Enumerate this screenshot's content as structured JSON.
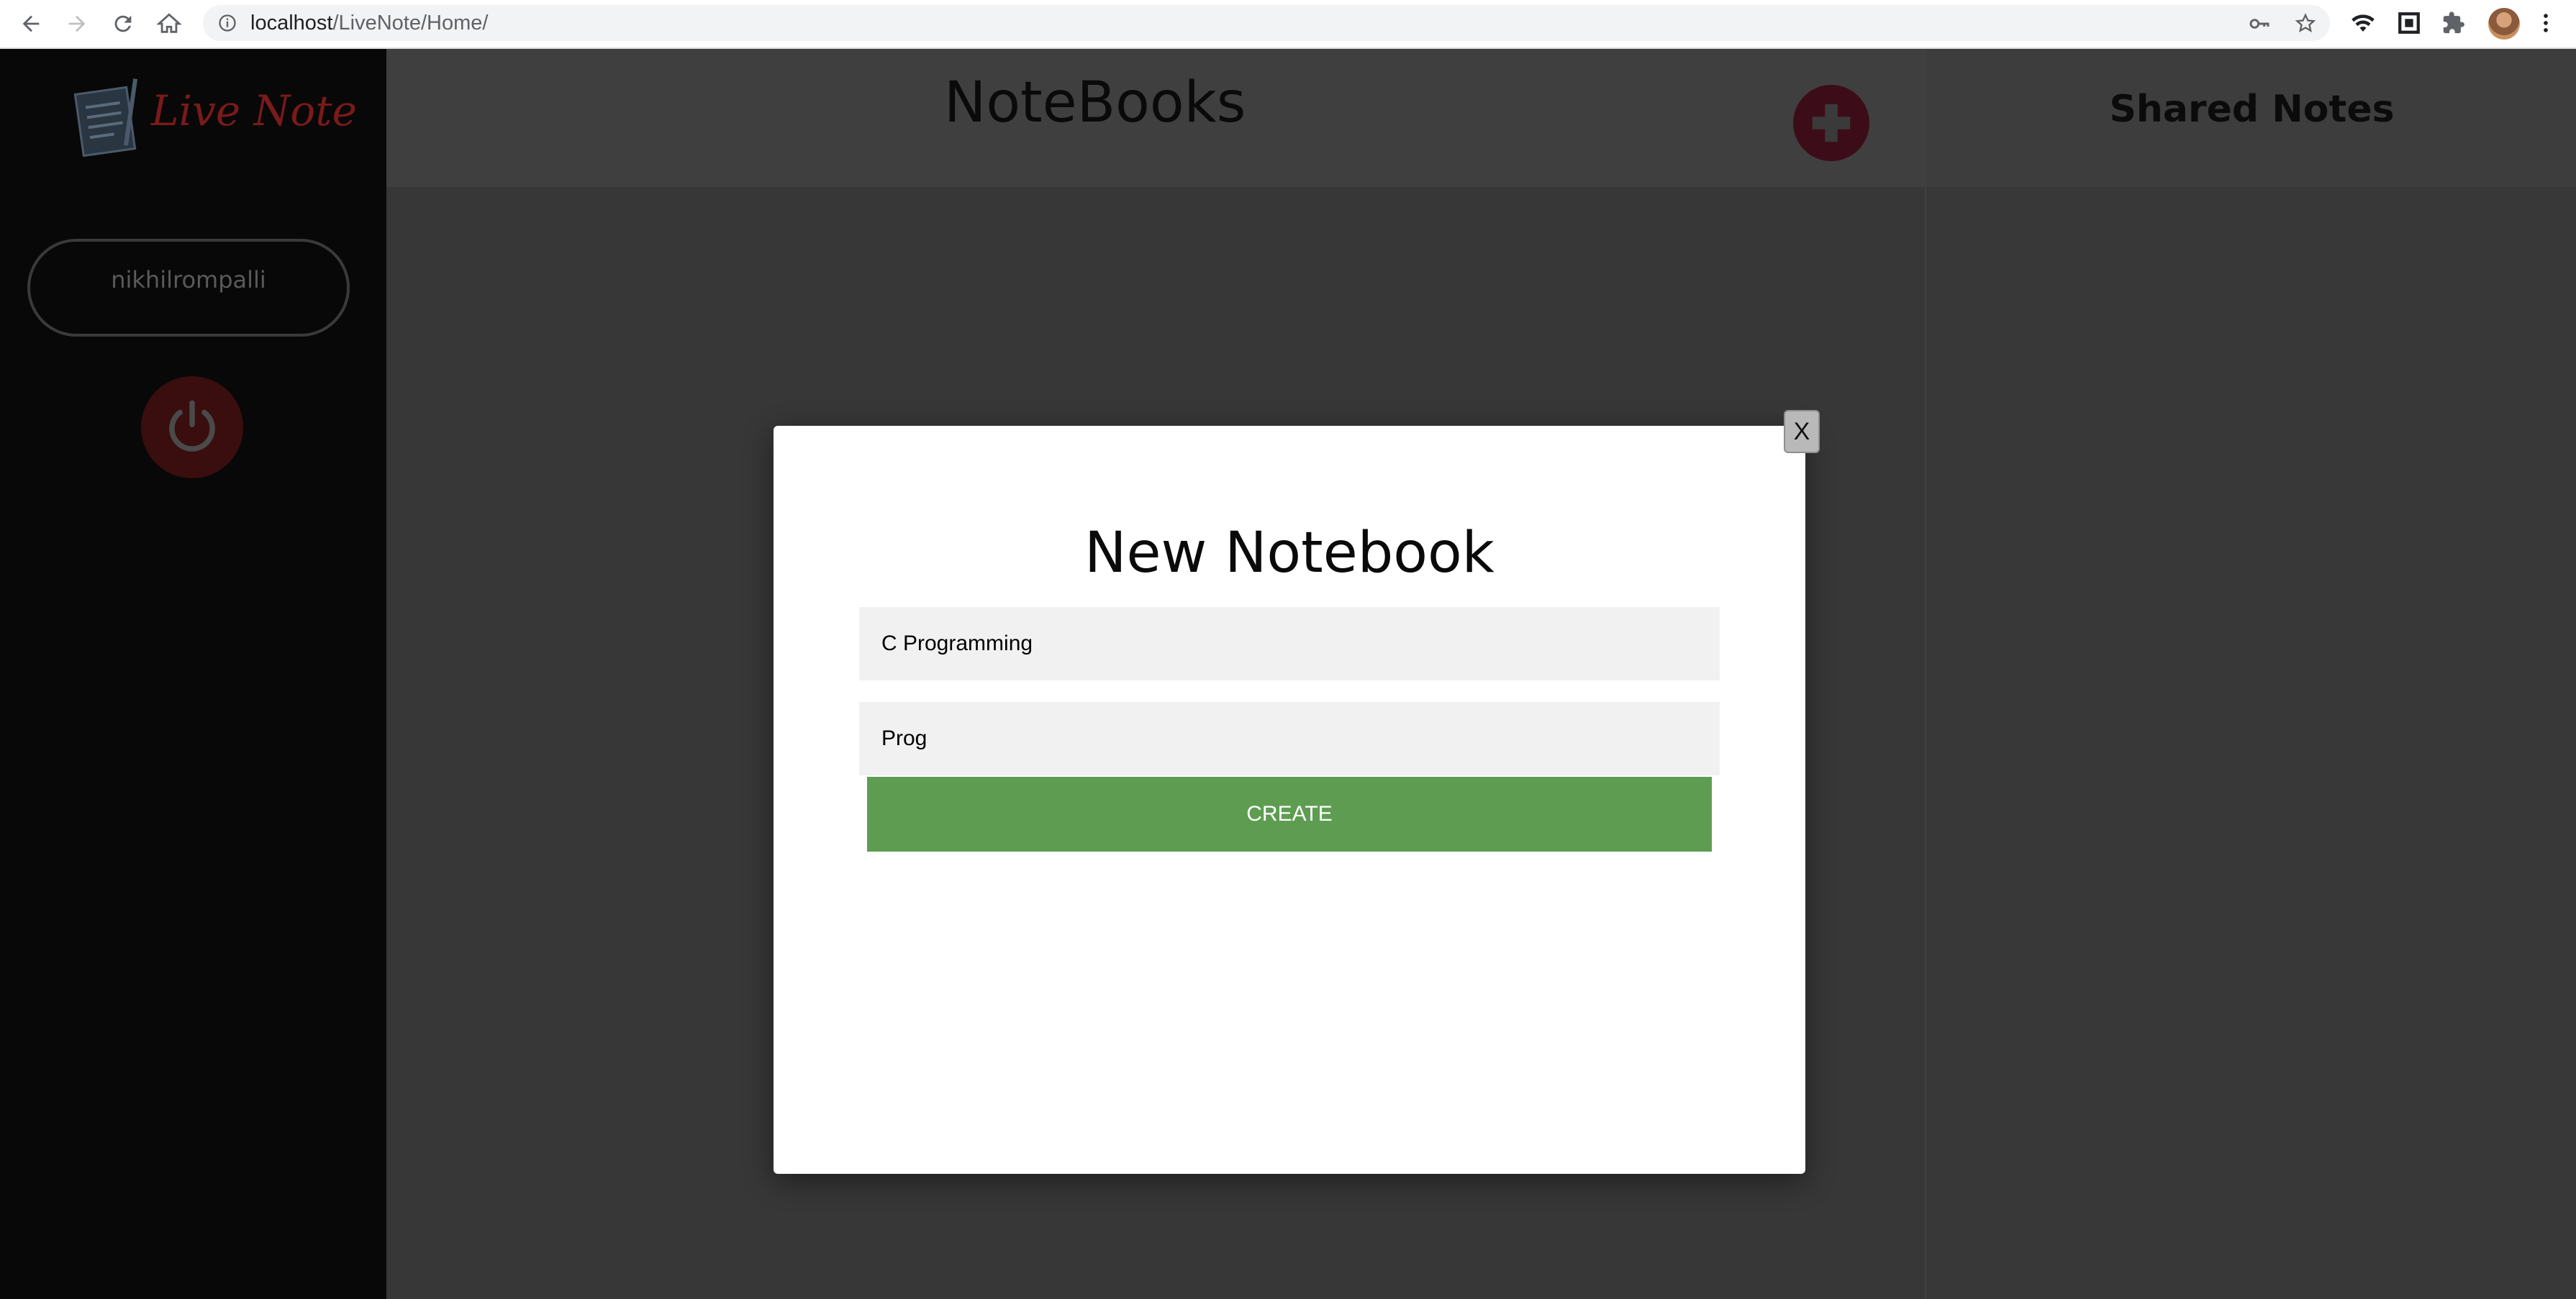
{
  "browser": {
    "url_host": "localhost",
    "url_path": "/LiveNote/Home/",
    "icons": {
      "back": "back-arrow-icon",
      "forward": "forward-arrow-icon",
      "reload": "reload-icon",
      "home": "home-icon",
      "info": "info-icon",
      "key": "key-icon",
      "star": "star-icon",
      "wifi": "wifi-icon",
      "extension": "extension-icon",
      "menu": "more-vert-icon"
    }
  },
  "sidebar": {
    "logo_text": "Live Note",
    "username": "nikhilrompalli",
    "logout_icon": "power-icon"
  },
  "main": {
    "title": "NoteBooks",
    "add_icon": "plus-circle-icon"
  },
  "shared": {
    "title": "Shared Notes"
  },
  "modal": {
    "close_label": "X",
    "title": "New Notebook",
    "name_value": "C Programming",
    "description_value": "Prog",
    "create_label": "CREATE"
  },
  "colors": {
    "create_button": "#5e9d51",
    "sidebar": "#080808",
    "main_bg": "#373737",
    "add_button": "#3c0d18",
    "power_button": "#3a0e0e"
  }
}
